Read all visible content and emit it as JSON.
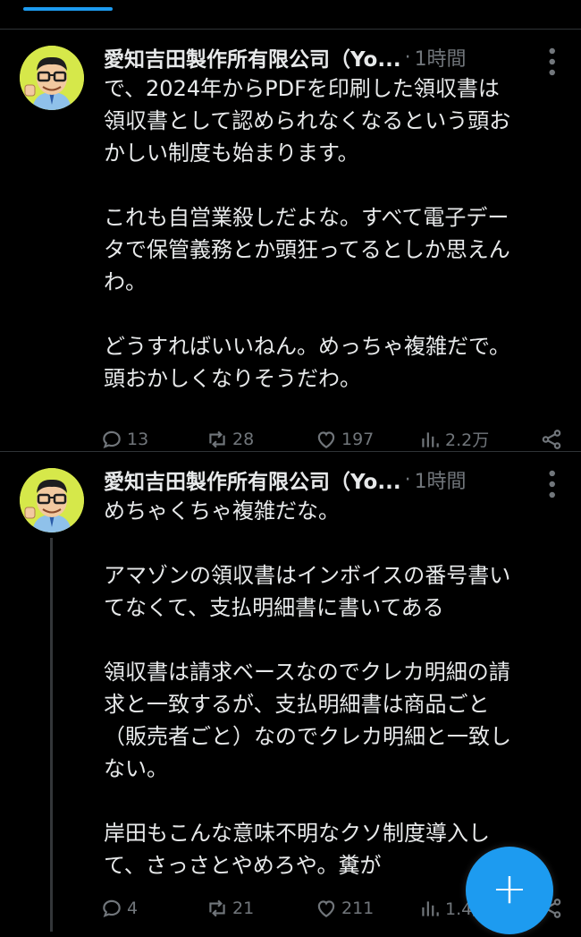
{
  "theme": {
    "background": "#000000",
    "text": "#e7e9ea",
    "muted": "#71767b",
    "accent": "#1d9bf0",
    "divider": "#2f3336"
  },
  "tweets": [
    {
      "author": "愛知吉田製作所有限公司（Yo...",
      "separator": "·",
      "time": "1時間",
      "avatar_icon": "cartoon-man-with-glasses-avatar",
      "text": "で、2024年からPDFを印刷した領収書は\n領収書として認められなくなるという頭お\nかしい制度も始まります。\n\nこれも自営業殺しだよな。すべて電子デー\nタで保管義務とか頭狂ってるとしか思えん\nわ。\n\nどうすればいいねん。めっちゃ複雑だで。\n頭おかしくなりそうだわ。",
      "replies": "13",
      "retweets": "28",
      "likes": "197",
      "views": "2.2万"
    },
    {
      "author": "愛知吉田製作所有限公司（Yo...",
      "separator": "·",
      "time": "1時間",
      "avatar_icon": "cartoon-man-with-glasses-avatar",
      "text": "めちゃくちゃ複雑だな。\n\nアマゾンの領収書はインボイスの番号書い\nてなくて、支払明細書に書いてある\n\n領収書は請求ベースなのでクレカ明細の請\n求と一致するが、支払明細書は商品ごと\n（販売者ごと）なのでクレカ明細と一致し\nない。\n\n岸田もこんな意味不明なクソ制度導入し\nて、さっさとやめろや。糞が",
      "replies": "4",
      "retweets": "21",
      "likes": "211",
      "views": "1.4万"
    }
  ],
  "fab": {
    "label": "+",
    "icon": "compose-plus-icon"
  }
}
